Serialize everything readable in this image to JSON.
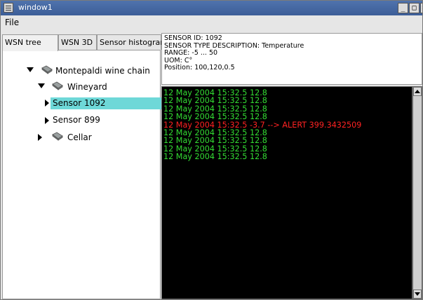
{
  "window": {
    "title": "window1"
  },
  "menu": {
    "file": "File"
  },
  "tabs": [
    {
      "label": "WSN tree"
    },
    {
      "label": "WSN 3D"
    },
    {
      "label": "Sensor histogram"
    }
  ],
  "tree": {
    "root": "Montepaldi wine chain",
    "wineyard": "Wineyard",
    "sensor1092": "Sensor 1092",
    "sensor899": "Sensor 899",
    "cellar": "Cellar"
  },
  "info": {
    "id": "SENSOR ID: 1092",
    "type": "SENSOR TYPE DESCRIPTION: Temperature",
    "range": "RANGE: -5 ... 50",
    "uom": "UOM: C°",
    "position": "Position: 100,120,0.5"
  },
  "log": [
    {
      "text": "12 May 2004 15:32.5 12.8"
    },
    {
      "text": "12 May 2004 15:32.5 12.8"
    },
    {
      "text": "12 May 2004 15:32.5 12.8"
    },
    {
      "text": "12 May 2004 15:32.5 12.8"
    },
    {
      "text": "12 May 2004 15:32.5 -3.7 --> ALERT 399.3432509"
    },
    {
      "text": "12 May 2004 15:32.5 12.8"
    },
    {
      "text": "12 May 2004 15:32.5 12.8"
    },
    {
      "text": "12 May 2004 15:32.5 12.8"
    },
    {
      "text": "12 May 2004 15:32.5 12.8"
    }
  ],
  "colors": {
    "normal": "#33dd33",
    "alert": "#ff2222",
    "selection": "#6ed8d8"
  },
  "alert_index": 4
}
